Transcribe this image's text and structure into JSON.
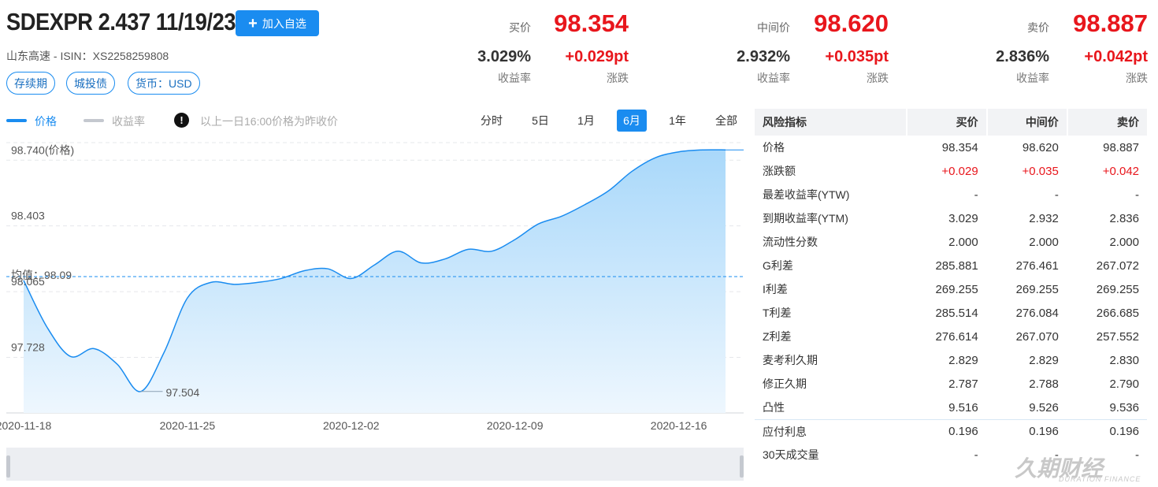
{
  "header": {
    "title": "SDEXPR 2.437 11/19/23",
    "watch_button": "加入自选",
    "subline": "山东高速 - ISIN：XS2258259808",
    "tags": [
      "存续期",
      "城投债",
      "货币：USD"
    ]
  },
  "quotes": [
    {
      "label": "买价",
      "price": "98.354",
      "yield": "3.029%",
      "yield_label": "收益率",
      "change": "+0.029pt",
      "change_label": "涨跌"
    },
    {
      "label": "中间价",
      "price": "98.620",
      "yield": "2.932%",
      "yield_label": "收益率",
      "change": "+0.035pt",
      "change_label": "涨跌"
    },
    {
      "label": "卖价",
      "price": "98.887",
      "yield": "2.836%",
      "yield_label": "收益率",
      "change": "+0.042pt",
      "change_label": "涨跌"
    }
  ],
  "legend": {
    "price": "价格",
    "yield": "收益率",
    "note": "以上一日16:00价格为昨收价",
    "price_color": "#1a8cf0",
    "yield_color": "#c4c8cf"
  },
  "periods": [
    "分时",
    "5日",
    "1月",
    "6月",
    "1年",
    "全部"
  ],
  "active_period": "6月",
  "chart_data": {
    "type": "area",
    "y_ticks": [
      "98.740(价格)",
      "98.403",
      "98.065",
      "97.728"
    ],
    "y_tick_values": [
      98.74,
      98.403,
      98.065,
      97.728
    ],
    "ylim": [
      97.39,
      98.83
    ],
    "x_ticks": [
      "2020-11-18",
      "2020-11-25",
      "2020-12-02",
      "2020-12-09",
      "2020-12-16"
    ],
    "average_label": "均值：98.09",
    "average": 98.09,
    "min_label": "97.504",
    "series": [
      {
        "x": [
          "2020-11-18",
          "2020-11-19",
          "2020-11-20",
          "2020-11-21",
          "2020-11-22",
          "2020-11-23",
          "2020-11-24",
          "2020-11-25",
          "2020-11-26",
          "2020-11-27",
          "2020-11-28",
          "2020-11-29",
          "2020-11-30",
          "2020-12-01",
          "2020-12-02",
          "2020-12-03",
          "2020-12-04",
          "2020-12-05",
          "2020-12-06",
          "2020-12-07",
          "2020-12-08",
          "2020-12-09",
          "2020-12-10",
          "2020-12-11",
          "2020-12-12",
          "2020-12-13",
          "2020-12-14",
          "2020-12-15",
          "2020-12-16",
          "2020-12-17",
          "2020-12-18"
        ],
        "y": [
          98.07,
          97.83,
          97.68,
          97.72,
          97.64,
          97.5,
          97.7,
          97.98,
          98.06,
          98.05,
          98.06,
          98.08,
          98.12,
          98.13,
          98.08,
          98.15,
          98.22,
          98.16,
          98.18,
          98.23,
          98.22,
          98.28,
          98.36,
          98.4,
          98.46,
          98.53,
          98.63,
          98.7,
          98.73,
          98.74,
          98.74
        ]
      }
    ]
  },
  "risk_table": {
    "headers": [
      "风险指标",
      "买价",
      "中间价",
      "卖价"
    ],
    "rows": [
      [
        "价格",
        "98.354",
        "98.620",
        "98.887"
      ],
      [
        "涨跌额",
        "+0.029",
        "+0.035",
        "+0.042"
      ],
      [
        "最差收益率(YTW)",
        "-",
        "-",
        "-"
      ],
      [
        "到期收益率(YTM)",
        "3.029",
        "2.932",
        "2.836"
      ],
      [
        "流动性分数",
        "2.000",
        "2.000",
        "2.000"
      ],
      [
        "G利差",
        "285.881",
        "276.461",
        "267.072"
      ],
      [
        "I利差",
        "269.255",
        "269.255",
        "269.255"
      ],
      [
        "T利差",
        "285.514",
        "276.084",
        "266.685"
      ],
      [
        "Z利差",
        "276.614",
        "267.070",
        "257.552"
      ],
      [
        "麦考利久期",
        "2.829",
        "2.829",
        "2.830"
      ],
      [
        "修正久期",
        "2.787",
        "2.788",
        "2.790"
      ],
      [
        "凸性",
        "9.516",
        "9.526",
        "9.536"
      ],
      [
        "应付利息",
        "0.196",
        "0.196",
        "0.196"
      ],
      [
        "30天成交量",
        "-",
        "-",
        "-"
      ]
    ]
  },
  "watermark": {
    "text": "久期财经",
    "sub": "DURATION FINANCE"
  }
}
